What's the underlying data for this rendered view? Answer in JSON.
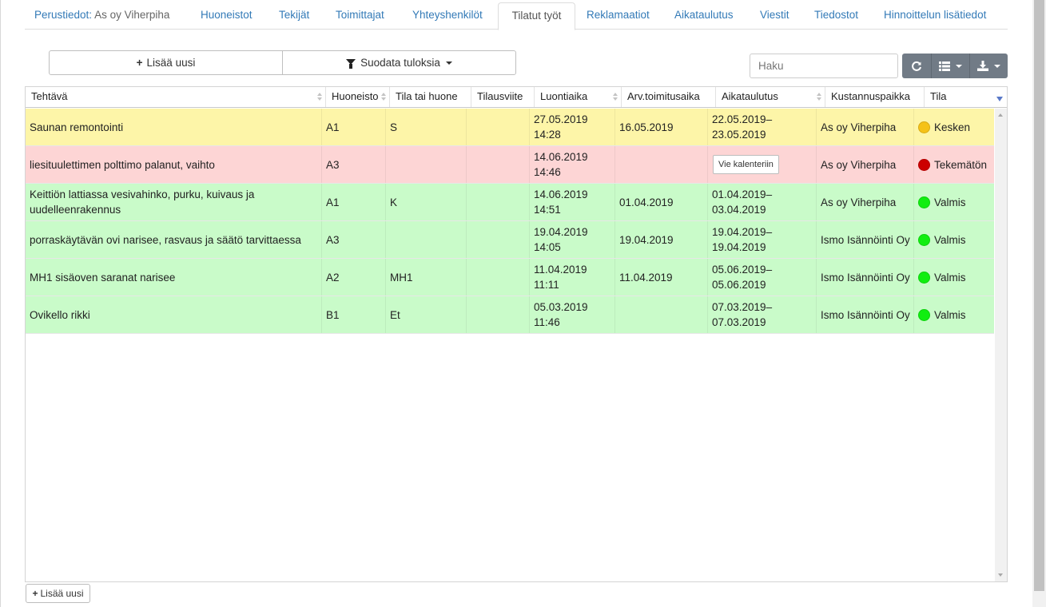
{
  "tabs": [
    {
      "label": "Perustiedot:",
      "value": "As oy Viherpiha",
      "active": false
    },
    {
      "label": "Huoneistot",
      "active": false
    },
    {
      "label": "Tekijät",
      "active": false
    },
    {
      "label": "Toimittajat",
      "active": false
    },
    {
      "label": "Yhteyshenkilöt",
      "active": false
    },
    {
      "label": "Tilatut työt",
      "active": true
    },
    {
      "label": "Reklamaatiot",
      "active": false
    },
    {
      "label": "Aikataulutus",
      "active": false
    },
    {
      "label": "Viestit",
      "active": false
    },
    {
      "label": "Tiedostot",
      "active": false
    },
    {
      "label": "Hinnoittelun lisätiedot",
      "active": false
    }
  ],
  "toolbar": {
    "add_new_label": "Lisää uusi",
    "filter_label": "Suodata tuloksia",
    "search_placeholder": "Haku"
  },
  "table": {
    "columns": [
      "Tehtävä",
      "Huoneisto",
      "Tila tai huone",
      "Tilausviite",
      "Luontiaika",
      "Arv.toimitusaika",
      "Aikataulutus",
      "Kustannuspaikka",
      "Tila"
    ],
    "rows": [
      {
        "color": "yellow",
        "task": "Saunan remontointi",
        "apartment": "A1",
        "room": "S",
        "order_ref": "",
        "created_date": "27.05.2019",
        "created_time": "14:28",
        "est_delivery": "16.05.2019",
        "schedule_start": "22.05.2019–",
        "schedule_end": "23.05.2019",
        "cost_center": "As oy Viherpiha",
        "status": "Kesken",
        "status_color": "#f5c218"
      },
      {
        "color": "red",
        "task": "liesituulettimen polttimo palanut, vaihto",
        "apartment": "A3",
        "room": "",
        "order_ref": "",
        "created_date": "14.06.2019",
        "created_time": "14:46",
        "est_delivery": "",
        "schedule_button": "Vie kalenteriin",
        "cost_center": "As oy Viherpiha",
        "status": "Tekemätön",
        "status_color": "#cc0000"
      },
      {
        "color": "green",
        "task": "Keittiön lattiassa vesivahinko, purku, kuivaus ja uudelleenrakennus",
        "apartment": "A1",
        "room": "K",
        "order_ref": "",
        "created_date": "14.06.2019",
        "created_time": "14:51",
        "est_delivery": "01.04.2019",
        "schedule_start": "01.04.2019–",
        "schedule_end": "03.04.2019",
        "cost_center": "As oy Viherpiha",
        "status": "Valmis",
        "status_color": "#11ee11"
      },
      {
        "color": "green",
        "task": "porraskäytävän ovi narisee, rasvaus ja säätö tarvittaessa",
        "apartment": "A3",
        "room": "",
        "order_ref": "",
        "created_date": "19.04.2019",
        "created_time": "14:05",
        "est_delivery": "19.04.2019",
        "schedule_start": "19.04.2019–",
        "schedule_end": "19.04.2019",
        "cost_center": "Ismo Isännöinti Oy",
        "status": "Valmis",
        "status_color": "#11ee11"
      },
      {
        "color": "green",
        "task": "MH1 sisäoven saranat narisee",
        "apartment": "A2",
        "room": "MH1",
        "order_ref": "",
        "created_date": "11.04.2019",
        "created_time": "11:11",
        "est_delivery": "11.04.2019",
        "schedule_start": "05.06.2019–",
        "schedule_end": "05.06.2019",
        "cost_center": "Ismo Isännöinti Oy",
        "status": "Valmis",
        "status_color": "#11ee11"
      },
      {
        "color": "green",
        "task": "Ovikello rikki",
        "apartment": "B1",
        "room": "Et",
        "order_ref": "",
        "created_date": "05.03.2019",
        "created_time": "11:46",
        "est_delivery": "",
        "schedule_start": "07.03.2019–",
        "schedule_end": "07.03.2019",
        "cost_center": "Ismo Isännöinti Oy",
        "status": "Valmis",
        "status_color": "#11ee11"
      }
    ]
  },
  "footer": {
    "add_new_label": "Lisää uusi"
  },
  "icons": {
    "plus": "plus-icon",
    "filter": "filter-icon",
    "refresh": "refresh-icon",
    "columns": "table-columns-icon",
    "export": "download-icon",
    "caret": "caret-down-icon"
  }
}
